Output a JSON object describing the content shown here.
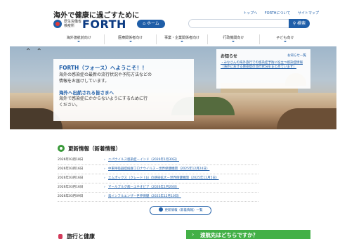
{
  "header": {
    "tagline": "海外で健康に過ごすために",
    "ministry_line1": "厚生労働省",
    "ministry_line2": "検疫所",
    "brand": "FORTH",
    "home_label": "ホーム",
    "top_links": [
      "トップへ",
      "FORTHについて",
      "サイトマップ"
    ],
    "search_placeholder": "",
    "search_label": "検索"
  },
  "nav": {
    "items": [
      "海外渡航前向け",
      "医療関係者向け",
      "事業・企業関係者向け",
      "行政機関向け",
      "子ども向け"
    ]
  },
  "hero": {
    "title": "FORTH（フォース）へようこそ！！",
    "line1": "海外の感染症の最新の流行状況や予防方法などの",
    "line2": "情報をお届けしています。",
    "sub_title": "海外へ出航される皆さまへ",
    "sub_line1": "海外で感染症にかからないようにするために行",
    "sub_line2": "ください。"
  },
  "notice": {
    "title": "お知らせ",
    "all_link": "お知らせ一覧",
    "text": "・みなさんの海外旅行での感染症予防に役立つ感染症情報（海外における感染症の流行状況をまとめています）"
  },
  "updates": {
    "title": "更新情報（新着情報）",
    "items": [
      {
        "date": "2026年03月18日",
        "text": "ニパウイルス感染症－インド（2026年1月30日）"
      },
      {
        "date": "2026年03月16日",
        "text": "中東呼吸器症候群コロナウイルス－世界保健機関（2025年12月24日）"
      },
      {
        "date": "2026年03月16日",
        "text": "エムポックス（クレード I b）の感染拡大－世界保健機関（2025年12月5日）"
      },
      {
        "date": "2026年03月16日",
        "text": "マールブルグ病－エチオピア（2026年1月26日）"
      },
      {
        "date": "2026年03月09日",
        "text": "鳥インフルエンザ－世界保健（2025年12月10日）"
      }
    ],
    "more_label": "更新情報（新着情報）一覧"
  },
  "bottom": {
    "travel_title": "旅行と健康",
    "dest_label": "渡航先はどちらですか？"
  }
}
